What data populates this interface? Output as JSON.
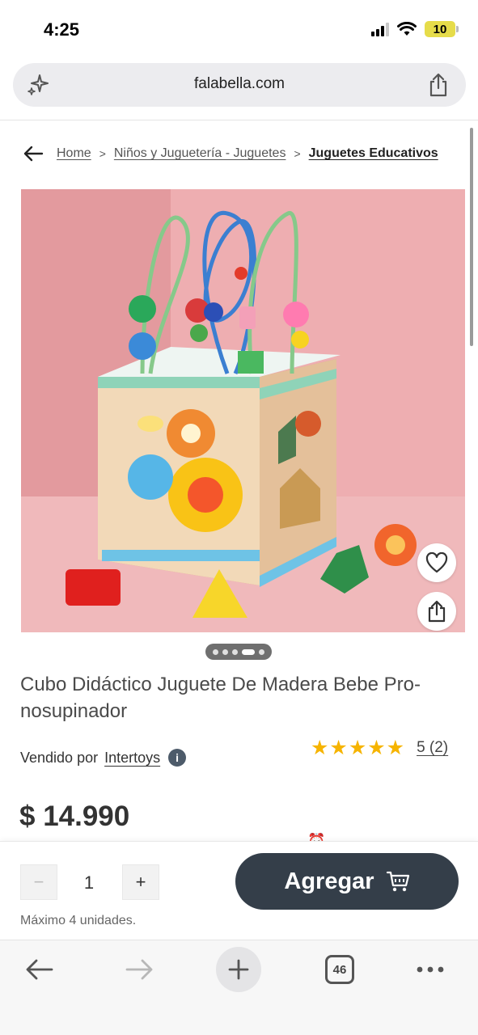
{
  "status_bar": {
    "time": "4:25",
    "battery": "10"
  },
  "browser": {
    "url": "falabella.com",
    "tabs_count": "46"
  },
  "breadcrumb": [
    {
      "label": "Home"
    },
    {
      "label": "Niños y Juguetería - Juguetes"
    },
    {
      "label": "Juguetes Educativos"
    }
  ],
  "breadcrumb_separator": ">",
  "product": {
    "title": "Cubo Didáctico Juguete De Madera Bebe Pro-nosupinador",
    "seller_prefix": "Vendido por",
    "seller_name": "Intertoys",
    "info_symbol": "i",
    "stars": "★★★★★",
    "rating": 5,
    "reviews": 2,
    "rating_text": "5 (2)",
    "price": "$ 14.990",
    "image_count": 5,
    "image_active_index": 3
  },
  "purchase": {
    "quantity": "1",
    "minus": "−",
    "plus": "+",
    "max_units": "Máximo 4 unidades.",
    "add_label": "Agregar"
  },
  "icons": {
    "sparkle": "sparkle-icon",
    "share": "share-icon",
    "back": "arrow-left-icon",
    "heart": "heart-icon",
    "cart": "cart-icon",
    "forward": "arrow-right-icon",
    "more": "more-icon"
  },
  "colors": {
    "add_button": "#343e49",
    "stars": "#f6b400",
    "product_bg": "#e9a8ab"
  }
}
